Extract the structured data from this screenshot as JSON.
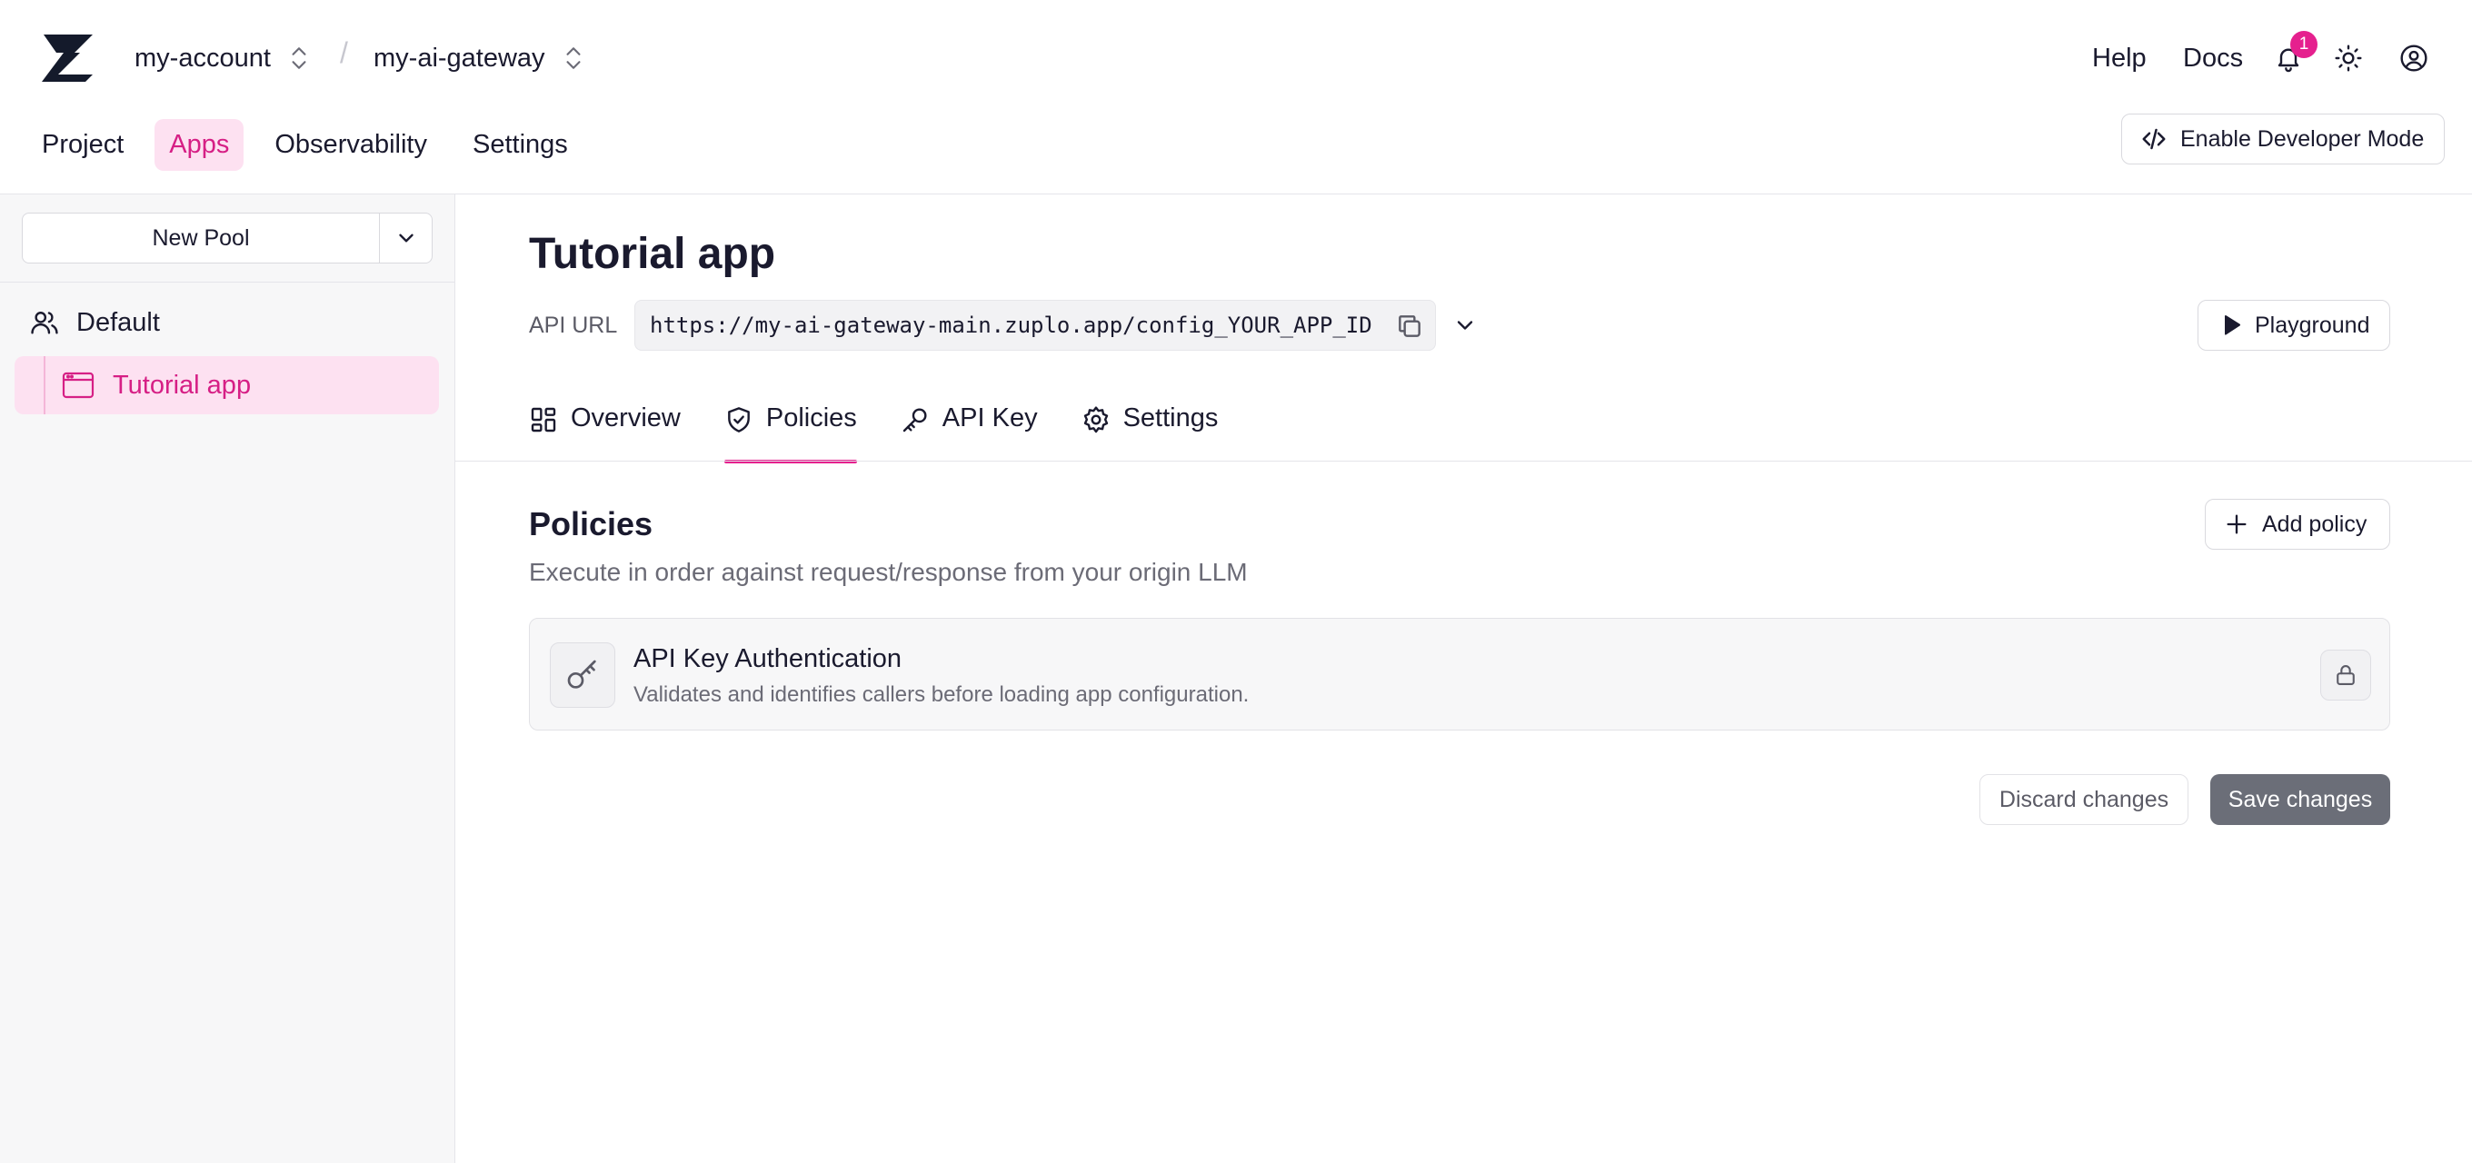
{
  "header": {
    "logo_icon": "zuplo-logo-icon",
    "account": "my-account",
    "project": "my-ai-gateway",
    "separator": "/",
    "help": "Help",
    "docs": "Docs",
    "notification_count": "1",
    "developer_mode": "Enable Developer Mode"
  },
  "nav": {
    "items": [
      {
        "label": "Project"
      },
      {
        "label": "Apps"
      },
      {
        "label": "Observability"
      },
      {
        "label": "Settings"
      }
    ],
    "active": "Apps"
  },
  "sidebar": {
    "new_pool": "New Pool",
    "group": "Default",
    "app": "Tutorial app"
  },
  "main": {
    "title": "Tutorial app",
    "api_url_label": "API URL",
    "api_url": "https://my-ai-gateway-main.zuplo.app/config_YOUR_APP_ID",
    "playground": "Playground",
    "tabs": [
      {
        "label": "Overview",
        "icon": "grid-icon"
      },
      {
        "label": "Policies",
        "icon": "shield-icon"
      },
      {
        "label": "API Key",
        "icon": "key-icon"
      },
      {
        "label": "Settings",
        "icon": "gear-icon"
      }
    ],
    "active_tab": "Policies"
  },
  "policies": {
    "title": "Policies",
    "description": "Execute in order against request/response from your origin LLM",
    "add_policy": "Add policy",
    "items": [
      {
        "name": "API Key Authentication",
        "description": "Validates and identifies callers before loading app configuration.",
        "locked": true
      }
    ],
    "discard": "Discard changes",
    "save": "Save changes"
  },
  "colors": {
    "accent": "#e5208e",
    "accent_bg": "#fde1f1",
    "save_button": "#6b6e78"
  }
}
